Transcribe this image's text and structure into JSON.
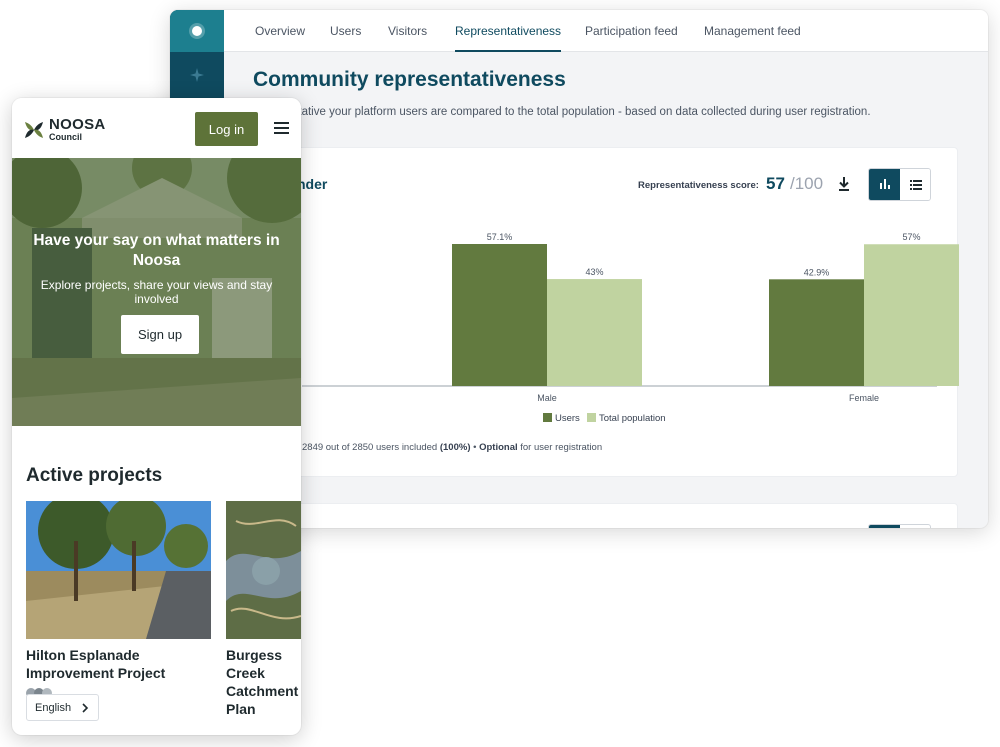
{
  "desktop": {
    "tabs": [
      {
        "label": "Overview"
      },
      {
        "label": "Users"
      },
      {
        "label": "Visitors"
      },
      {
        "label": "Representativeness"
      },
      {
        "label": "Participation feed"
      },
      {
        "label": "Management feed"
      }
    ],
    "active_tab": "Representativeness",
    "title": "Community representativeness",
    "description": "representative your platform users are compared to the total population - based on data collected during user registration.",
    "card": {
      "title": "nder",
      "score_label": "Representativeness score:",
      "score_value": "57",
      "score_max": "/100",
      "footer_count": "2849 out of 2850 users included",
      "footer_pct": "(100%)",
      "footer_sep": " • ",
      "footer_optional": "Optional",
      "footer_rest": " for user registration"
    }
  },
  "chart_data": {
    "type": "bar",
    "categories": [
      "Male",
      "Female"
    ],
    "series": [
      {
        "name": "Users",
        "values": [
          57.1,
          42.9
        ],
        "labels": [
          "57.1%",
          "42.9%"
        ],
        "color": "#627a3f"
      },
      {
        "name": "Total population",
        "values": [
          43,
          57
        ],
        "labels": [
          "43%",
          "57%"
        ],
        "color": "#c0d3a0"
      }
    ],
    "ylim": [
      0,
      57.1
    ],
    "legend": "bottom-center",
    "grid": false
  },
  "mobile": {
    "logo_name": "NOOSA",
    "logo_sub": "Council",
    "login_label": "Log in",
    "hero_title": "Have your say on what matters in Noosa",
    "hero_subtitle": "Explore projects, share your views and stay involved",
    "signup_label": "Sign up",
    "active_projects_title": "Active projects",
    "projects": [
      {
        "name": "Hilton Esplanade Improvement Project"
      },
      {
        "name": "Burgess Creek Catchment Plan"
      }
    ],
    "language": "English"
  },
  "colors": {
    "brand_teal": "#0f4a5f",
    "brand_green": "#5e7339",
    "users_series": "#627a3f",
    "population_series": "#c0d3a0"
  },
  "icons": [
    "plus-circle-icon",
    "sparkle-icon",
    "download-icon",
    "bar-chart-icon",
    "list-icon",
    "menu-icon",
    "chevron-right-icon"
  ]
}
